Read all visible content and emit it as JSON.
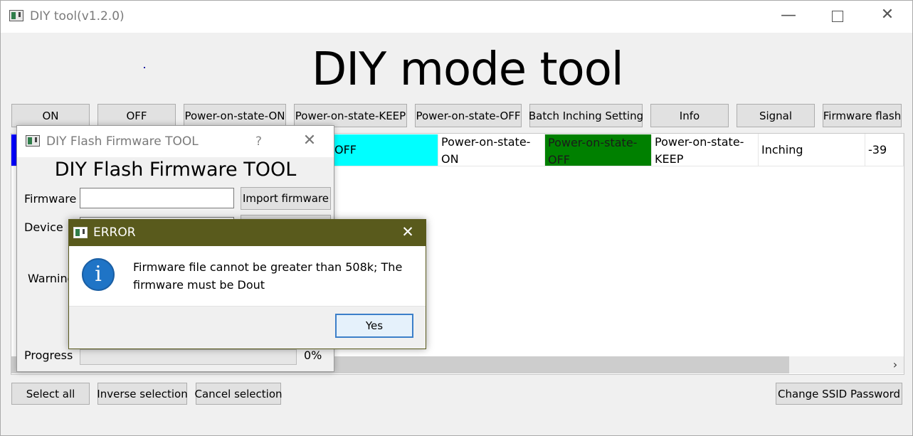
{
  "window": {
    "title": "DIY tool(v1.2.0)",
    "icons": [
      "app-icon",
      "minimize-icon",
      "maximize-icon",
      "close-icon"
    ]
  },
  "heading": "DIY mode tool",
  "toolbar": {
    "on": "ON",
    "off": "OFF",
    "power_on_state_on": "Power-on-state-ON",
    "power_on_state_keep": "Power-on-state-KEEP",
    "power_on_state_off": "Power-on-state-OFF",
    "batch_inching": "Batch Inching Setting",
    "info": "Info",
    "signal": "Signal",
    "firmware_flash": "Firmware flash"
  },
  "table": {
    "row1": [
      "OFF",
      "Power-on-state-ON",
      "Power-on-state-OFF",
      "Power-on-state-KEEP",
      "Inching",
      "-39"
    ],
    "colors": {
      "selected": "#0000ff",
      "state_off": "#00ffff",
      "power_off": "#008000"
    }
  },
  "bottom": {
    "select_all": "Select all",
    "inverse_selection": "Inverse selection",
    "cancel_selection": "Cancel selection",
    "change_ssid": "Change SSID  Password"
  },
  "flash_dialog": {
    "title": "DIY Flash Firmware TOOL",
    "help": "?",
    "heading": "DIY Flash Firmware TOOL",
    "firmware_label": "Firmware",
    "firmware_value": "",
    "import_button": "Import firmware",
    "device_label": "Device",
    "warning_label": "Warning",
    "progress_label": "Progress",
    "progress_value": "0%",
    "progress": 0
  },
  "error_dialog": {
    "title": "ERROR",
    "message_line1": "Firmware file cannot be greater than 508k; The",
    "message_line2": "firmware must be Dout",
    "yes_button": "Yes",
    "title_color": "#595a1c"
  }
}
